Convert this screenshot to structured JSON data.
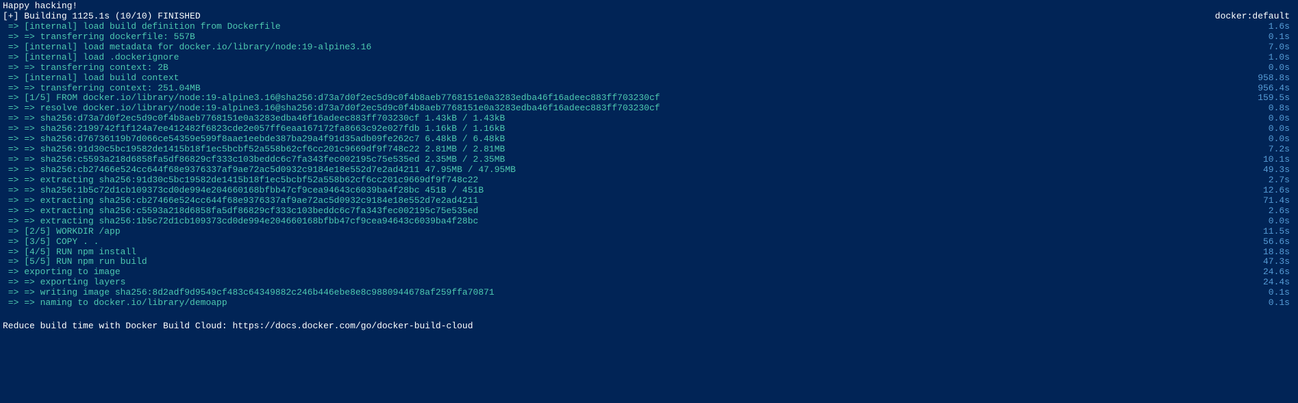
{
  "header": {
    "happy": "Happy hacking!",
    "build_status_left": "[+] Building 1125.1s (10/10) FINISHED",
    "build_status_right": "docker:default"
  },
  "steps": [
    {
      "text": "=> [internal] load build definition from Dockerfile",
      "time": "1.6s"
    },
    {
      "text": "=> => transferring dockerfile: 557B",
      "time": "0.1s"
    },
    {
      "text": "=> [internal] load metadata for docker.io/library/node:19-alpine3.16",
      "time": "7.0s"
    },
    {
      "text": "=> [internal] load .dockerignore",
      "time": "1.0s"
    },
    {
      "text": "=> => transferring context: 2B",
      "time": "0.0s"
    },
    {
      "text": "=> [internal] load build context",
      "time": "958.8s"
    },
    {
      "text": "=> => transferring context: 251.04MB",
      "time": "956.4s"
    },
    {
      "text": "=> [1/5] FROM docker.io/library/node:19-alpine3.16@sha256:d73a7d0f2ec5d9c0f4b8aeb7768151e0a3283edba46f16adeec883ff703230cf",
      "time": "159.5s"
    },
    {
      "text": "=> => resolve docker.io/library/node:19-alpine3.16@sha256:d73a7d0f2ec5d9c0f4b8aeb7768151e0a3283edba46f16adeec883ff703230cf",
      "time": "0.8s"
    },
    {
      "text": "=> => sha256:d73a7d0f2ec5d9c0f4b8aeb7768151e0a3283edba46f16adeec883ff703230cf 1.43kB / 1.43kB",
      "time": "0.0s"
    },
    {
      "text": "=> => sha256:2199742f1f124a7ee412482f6823cde2e057ff6eaa167172fa8663c92e027fdb 1.16kB / 1.16kB",
      "time": "0.0s"
    },
    {
      "text": "=> => sha256:d76736119b7d066ce54359e599f8aae1eebde387ba29a4f91d35adb09fe262c7 6.48kB / 6.48kB",
      "time": "0.0s"
    },
    {
      "text": "=> => sha256:91d30c5bc19582de1415b18f1ec5bcbf52a558b62cf6cc201c9669df9f748c22 2.81MB / 2.81MB",
      "time": "7.2s"
    },
    {
      "text": "=> => sha256:c5593a218d6858fa5df86829cf333c103beddc6c7fa343fec002195c75e535ed 2.35MB / 2.35MB",
      "time": "10.1s"
    },
    {
      "text": "=> => sha256:cb27466e524cc644f68e9376337af9ae72ac5d0932c9184e18e552d7e2ad4211 47.95MB / 47.95MB",
      "time": "49.3s"
    },
    {
      "text": "=> => extracting sha256:91d30c5bc19582de1415b18f1ec5bcbf52a558b62cf6cc201c9669df9f748c22",
      "time": "2.7s"
    },
    {
      "text": "=> => sha256:1b5c72d1cb109373cd0de994e204660168bfbb47cf9cea94643c6039ba4f28bc 451B / 451B",
      "time": "12.6s"
    },
    {
      "text": "=> => extracting sha256:cb27466e524cc644f68e9376337af9ae72ac5d0932c9184e18e552d7e2ad4211",
      "time": "71.4s"
    },
    {
      "text": "=> => extracting sha256:c5593a218d6858fa5df86829cf333c103beddc6c7fa343fec002195c75e535ed",
      "time": "2.6s"
    },
    {
      "text": "=> => extracting sha256:1b5c72d1cb109373cd0de994e204660168bfbb47cf9cea94643c6039ba4f28bc",
      "time": "0.0s"
    },
    {
      "text": "=> [2/5] WORKDIR /app",
      "time": "11.5s"
    },
    {
      "text": "=> [3/5] COPY . .",
      "time": "56.6s"
    },
    {
      "text": "=> [4/5] RUN npm install",
      "time": "18.8s"
    },
    {
      "text": "=> [5/5] RUN npm run build",
      "time": "47.3s"
    },
    {
      "text": "=> exporting to image",
      "time": "24.6s"
    },
    {
      "text": "=> => exporting layers",
      "time": "24.4s"
    },
    {
      "text": "=> => writing image sha256:8d2adf9d9549cf483c64349882c246b446ebe8e8c9880944678af259ffa70871",
      "time": "0.1s"
    },
    {
      "text": "=> => naming to docker.io/library/demoapp",
      "time": "0.1s"
    }
  ],
  "footer": {
    "text": "Reduce build time with Docker Build Cloud: https://docs.docker.com/go/docker-build-cloud"
  }
}
